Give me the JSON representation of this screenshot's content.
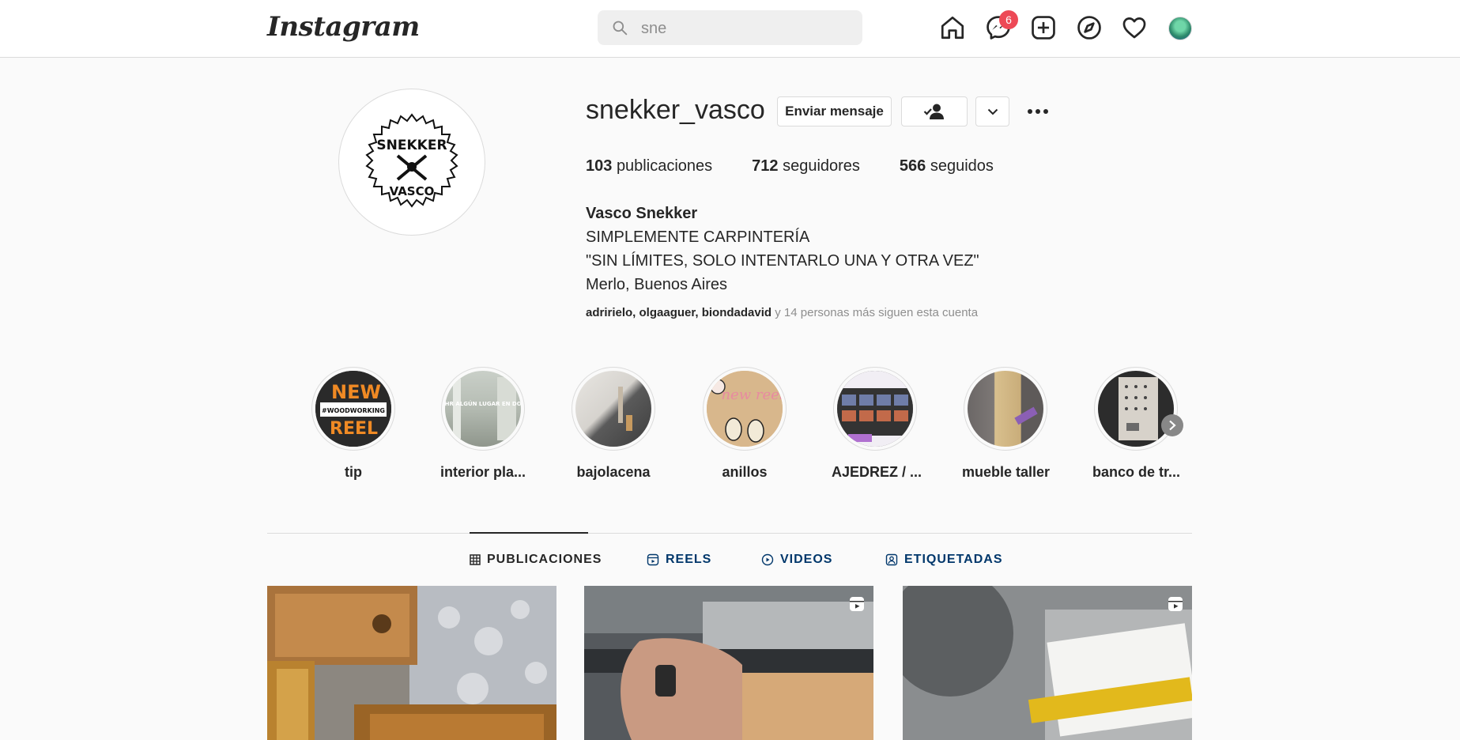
{
  "nav": {
    "logo": "Instagram",
    "search_value": "sne",
    "messages_badge": "6"
  },
  "profile": {
    "username": "snekker_vasco",
    "message_button": "Enviar mensaje",
    "stats": {
      "posts_count": "103",
      "posts_label": "publicaciones",
      "followers_count": "712",
      "followers_label": "seguidores",
      "following_count": "566",
      "following_label": "seguidos"
    },
    "bio": {
      "name": "Vasco Snekker",
      "line1": "SIMPLEMENTE CARPINTERÍA",
      "line2": "\"SIN LÍMITES, SOLO INTENTARLO UNA Y OTRA VEZ\"",
      "line3": "Merlo, Buenos Aires"
    },
    "followed_by_users": "adririelo, olgaaguer, biondadavid",
    "followed_by_rest": "y 14 personas más siguen esta cuenta",
    "logo_text_top": "SNEKKER",
    "logo_text_bottom": "VASCO"
  },
  "highlights": [
    {
      "label": "tip"
    },
    {
      "label": "interior pla..."
    },
    {
      "label": "bajolacena"
    },
    {
      "label": "anillos"
    },
    {
      "label": "AJEDREZ / ..."
    },
    {
      "label": "mueble taller"
    },
    {
      "label": "banco de tr..."
    }
  ],
  "highlight_texts": {
    "tip_new": "NEW",
    "tip_reel": "REEL",
    "tip_tag": "#WOODWORKING",
    "interior_text": "YO QUIERO HR ALGÚN LUGAR EN DONDE PUEDA",
    "anillos_text": "new reel"
  },
  "tabs": {
    "posts": "PUBLICACIONES",
    "reels": "REELS",
    "videos": "VIDEOS",
    "tagged": "ETIQUETADAS"
  },
  "colors": {
    "badge": "#ed4956",
    "link": "#00376b"
  }
}
